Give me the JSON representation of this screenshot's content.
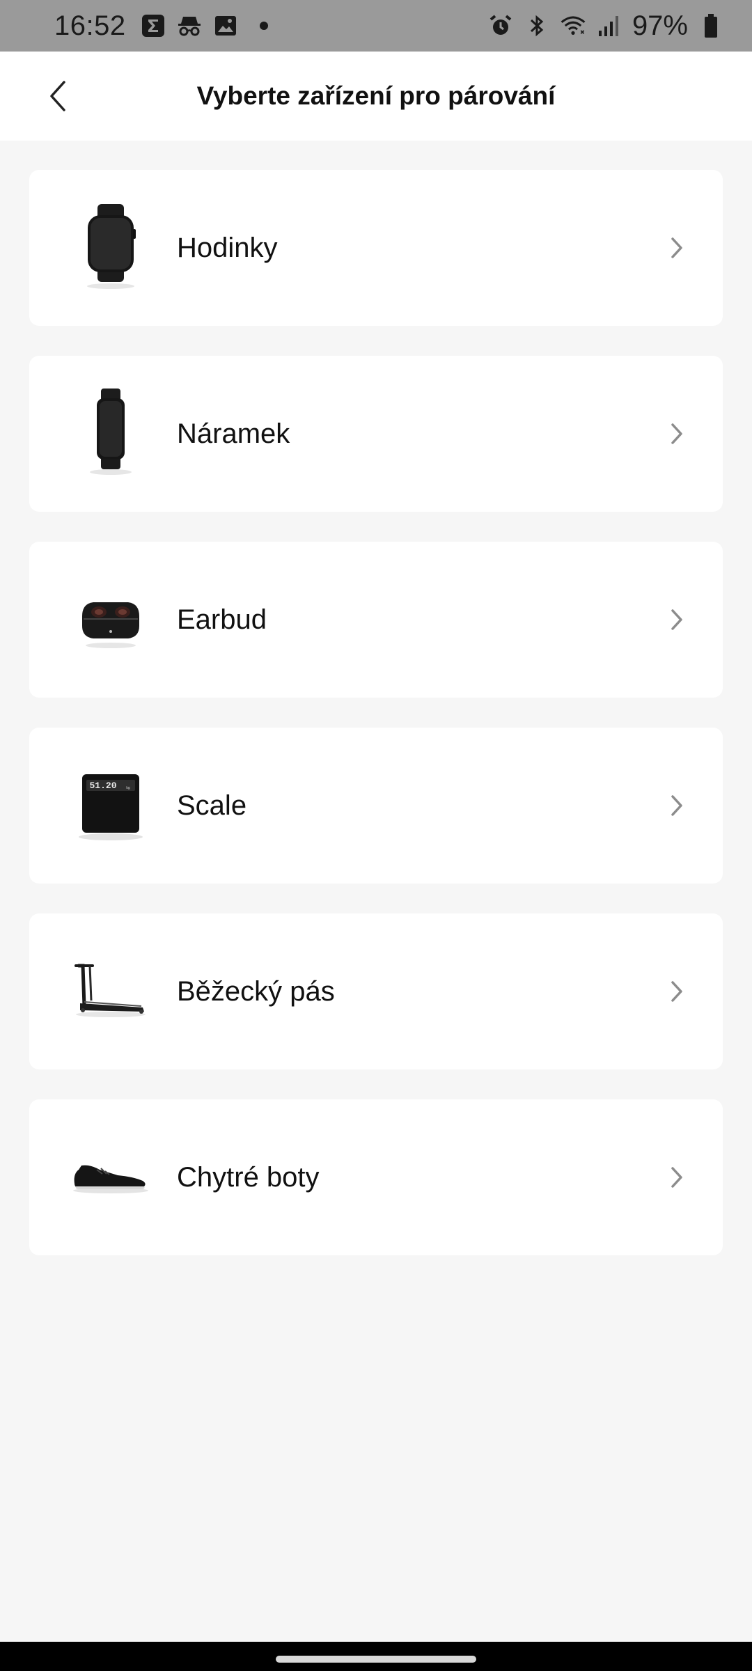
{
  "status_bar": {
    "time": "16:52",
    "battery_text": "97%",
    "left_icons": [
      "sigma-app-icon",
      "incognito-icon",
      "gallery-icon",
      "notification-dot-icon"
    ],
    "right_icons": [
      "alarm-icon",
      "bluetooth-icon",
      "wifi-icon",
      "signal-icon",
      "battery-icon"
    ]
  },
  "header": {
    "title": "Vyberte zařízení pro párování",
    "back_icon": "back-arrow-icon"
  },
  "devices": [
    {
      "label": "Hodinky",
      "icon": "smartwatch-icon"
    },
    {
      "label": "Náramek",
      "icon": "fitness-band-icon"
    },
    {
      "label": "Earbud",
      "icon": "earbuds-case-icon"
    },
    {
      "label": "Scale",
      "icon": "scale-icon",
      "scale_reading": "51.20"
    },
    {
      "label": "Běžecký pás",
      "icon": "treadmill-icon"
    },
    {
      "label": "Chytré boty",
      "icon": "smart-shoe-icon"
    }
  ],
  "colors": {
    "background": "#f6f6f6",
    "card": "#ffffff",
    "status_bar": "#9a9a9a",
    "chevron": "#8c8c8c"
  }
}
